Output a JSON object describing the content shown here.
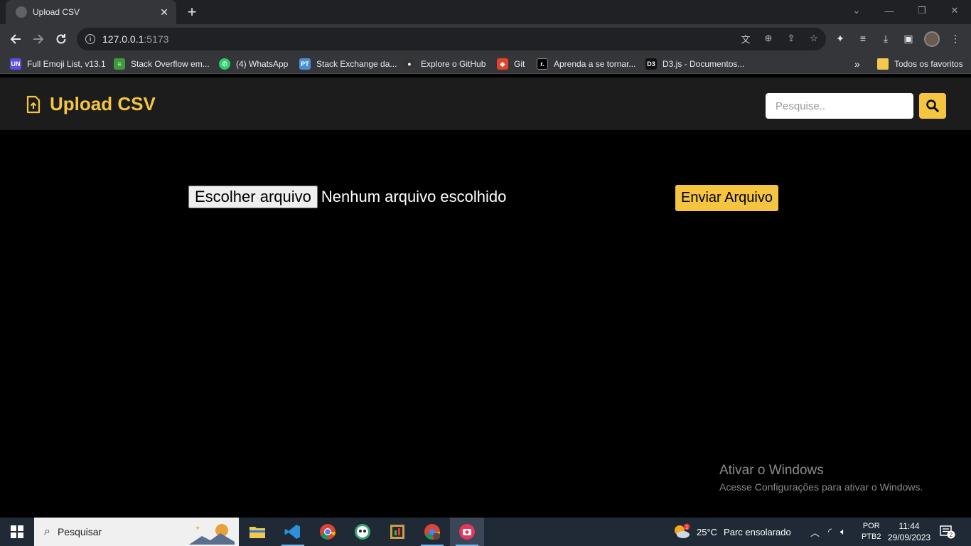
{
  "browser": {
    "tab_title": "Upload CSV",
    "tab_close": "✕",
    "new_tab": "+",
    "url_host": "127.0.0.1",
    "url_port": ":5173",
    "bookmarks": [
      {
        "label": "Full Emoji List, v13.1",
        "icon": "UN",
        "color": "#5b4fe0"
      },
      {
        "label": "Stack Overflow em...",
        "icon": "≡",
        "color": "#3f9a3a"
      },
      {
        "label": "(4) WhatsApp",
        "icon": "✆",
        "color": "#25d366"
      },
      {
        "label": "Stack Exchange da...",
        "icon": "PT",
        "color": "#4a8fd6"
      },
      {
        "label": "Explore o GitHub",
        "icon": "●",
        "color": "#333333"
      },
      {
        "label": "Git",
        "icon": "◆",
        "color": "#e24329"
      },
      {
        "label": "Aprenda a se tornar...",
        "icon": "r.",
        "color": "#000000"
      },
      {
        "label": "D3.js - Documentos...",
        "icon": "D3",
        "color": "#111111"
      }
    ],
    "bookmarks_more": "»",
    "all_favorites": "Todos os favoritos"
  },
  "header": {
    "title": "Upload CSV",
    "search_placeholder": "Pesquise..",
    "accent": "#f5c542"
  },
  "upload": {
    "choose_button": "Escolher arquivo",
    "file_status": "Nenhum arquivo escolhido",
    "send_button": "Enviar Arquivo"
  },
  "activation": {
    "title": "Ativar o Windows",
    "subtitle": "Acesse Configurações para ativar o Windows."
  },
  "taskbar": {
    "search_text": "Pesquisar",
    "weather_temp": "25°C",
    "weather_desc": "Parc ensolarado",
    "lang_top": "POR",
    "lang_bottom": "PTB2",
    "time": "11:44",
    "date": "29/09/2023",
    "notifications": "2",
    "weather_badge": "1"
  }
}
